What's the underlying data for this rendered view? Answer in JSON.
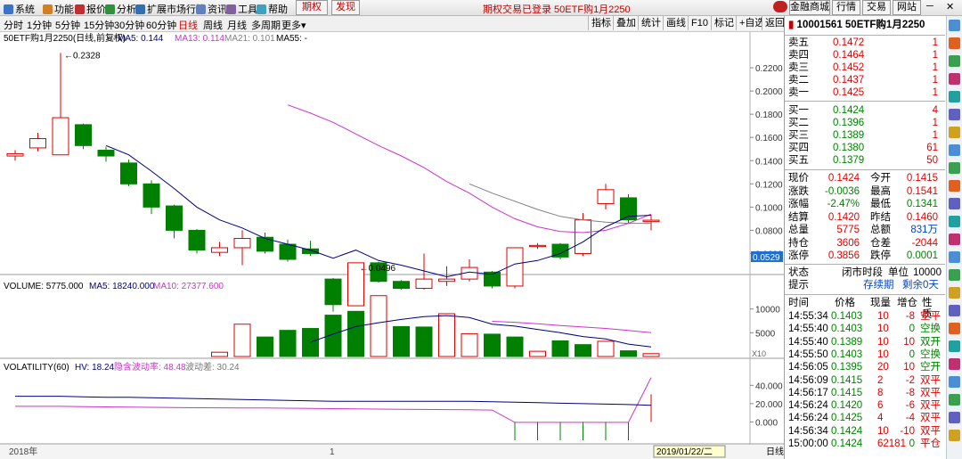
{
  "menu": [
    "系统",
    "功能",
    "报价",
    "分析",
    "扩展市场行情",
    "资讯",
    "工具",
    "帮助"
  ],
  "menu_tags": {
    "qiquan": "期权",
    "faxian": "发现"
  },
  "title_bar": "期权交易已登录  50ETF购1月2250",
  "top_buttons": [
    "金融商城",
    "行情",
    "交易",
    "网站"
  ],
  "periods": [
    "分时",
    "1分钟",
    "5分钟",
    "15分钟",
    "30分钟",
    "60分钟",
    "日线",
    "周线",
    "月线",
    "多周期",
    "更多"
  ],
  "toolbar": [
    "指标",
    "叠加",
    "统计",
    "画线",
    "F10",
    "标记",
    "+自选",
    "返回"
  ],
  "chart_data": [
    {
      "type": "candlestick",
      "title": "50ETF购1月2250(日线,前复权)",
      "ma_labels": {
        "ma5": "MA5: 0.144",
        "ma13": "MA13: 0.114",
        "ma21": "MA21: 0.101",
        "ma55": "MA55: -"
      },
      "ylim": [
        0.045,
        0.24
      ],
      "y_ticks": [
        "0.2200",
        "0.2000",
        "0.1800",
        "0.1600",
        "0.1400",
        "0.1200",
        "0.1000",
        "0.0800",
        "0.0600"
      ],
      "y_tick_values": [
        0.22,
        0.2,
        0.18,
        0.16,
        0.14,
        0.12,
        0.1,
        0.08,
        0.06
      ],
      "low_tag": "0.0529",
      "annotations": {
        "high": "0.2328",
        "low": "0.0496"
      },
      "candles": [
        {
          "o": 0.144,
          "c": 0.146,
          "h": 0.149,
          "l": 0.14
        },
        {
          "o": 0.151,
          "c": 0.159,
          "h": 0.164,
          "l": 0.148
        },
        {
          "o": 0.145,
          "c": 0.177,
          "h": 0.2328,
          "l": 0.145
        },
        {
          "o": 0.171,
          "c": 0.153,
          "h": 0.172,
          "l": 0.15
        },
        {
          "o": 0.149,
          "c": 0.144,
          "h": 0.152,
          "l": 0.139
        },
        {
          "o": 0.138,
          "c": 0.12,
          "h": 0.141,
          "l": 0.118
        },
        {
          "o": 0.12,
          "c": 0.1,
          "h": 0.123,
          "l": 0.094
        },
        {
          "o": 0.101,
          "c": 0.08,
          "h": 0.102,
          "l": 0.073
        },
        {
          "o": 0.08,
          "c": 0.063,
          "h": 0.081,
          "l": 0.06
        },
        {
          "o": 0.061,
          "c": 0.065,
          "h": 0.07,
          "l": 0.058
        },
        {
          "o": 0.065,
          "c": 0.073,
          "h": 0.08,
          "l": 0.05
        },
        {
          "o": 0.074,
          "c": 0.062,
          "h": 0.078,
          "l": 0.06
        },
        {
          "o": 0.068,
          "c": 0.055,
          "h": 0.072,
          "l": 0.053
        },
        {
          "o": 0.064,
          "c": 0.06,
          "h": 0.071,
          "l": 0.058
        },
        {
          "o": 0.038,
          "c": 0.016,
          "h": 0.039,
          "l": 0.01
        },
        {
          "o": 0.015,
          "c": 0.052,
          "h": 0.052,
          "l": 0.0496
        },
        {
          "o": 0.052,
          "c": 0.036,
          "h": 0.053,
          "l": 0.035
        },
        {
          "o": 0.036,
          "c": 0.03,
          "h": 0.037,
          "l": 0.029
        },
        {
          "o": 0.03,
          "c": 0.038,
          "h": 0.06,
          "l": 0.029
        },
        {
          "o": 0.036,
          "c": 0.038,
          "h": 0.049,
          "l": 0.032
        },
        {
          "o": 0.038,
          "c": 0.048,
          "h": 0.055,
          "l": 0.036
        },
        {
          "o": 0.044,
          "c": 0.032,
          "h": 0.045,
          "l": 0.03
        },
        {
          "o": 0.032,
          "c": 0.065,
          "h": 0.065,
          "l": 0.03
        },
        {
          "o": 0.066,
          "c": 0.067,
          "h": 0.069,
          "l": 0.064
        },
        {
          "o": 0.068,
          "c": 0.057,
          "h": 0.069,
          "l": 0.055
        },
        {
          "o": 0.06,
          "c": 0.089,
          "h": 0.095,
          "l": 0.058
        },
        {
          "o": 0.103,
          "c": 0.115,
          "h": 0.12,
          "l": 0.098
        },
        {
          "o": 0.108,
          "c": 0.089,
          "h": 0.111,
          "l": 0.086
        },
        {
          "o": 0.0875,
          "c": 0.0887,
          "h": 0.093,
          "l": 0.08
        }
      ],
      "ma5": [
        null,
        null,
        null,
        null,
        0.153,
        0.145,
        0.131,
        0.116,
        0.1,
        0.089,
        0.082,
        0.073,
        0.068,
        0.063,
        0.056,
        0.063,
        0.054,
        0.05,
        0.045,
        0.04,
        0.044,
        0.042,
        0.051,
        0.054,
        0.06,
        0.07,
        0.083,
        0.092,
        0.093
      ],
      "ma13": [
        null,
        null,
        null,
        null,
        null,
        null,
        null,
        null,
        null,
        null,
        null,
        null,
        0.188,
        0.181,
        0.173,
        0.163,
        0.153,
        0.144,
        0.134,
        0.122,
        0.112,
        0.1,
        0.09,
        0.083,
        0.079,
        0.078,
        0.08,
        0.086,
        0.094
      ],
      "ma21": [
        null,
        null,
        null,
        null,
        null,
        null,
        null,
        null,
        null,
        null,
        null,
        null,
        null,
        null,
        null,
        null,
        null,
        null,
        null,
        null,
        0.12,
        0.112,
        0.105,
        0.098,
        0.092,
        0.089,
        0.087,
        0.086,
        0.086
      ]
    },
    {
      "type": "bar",
      "title": "VOLUME",
      "labels": {
        "vol": "VOLUME: 5775.000",
        "ma5": "MA5: 18240.000",
        "ma10": "MA10: 27377.600"
      },
      "y_ticks": [
        "10000",
        "5000"
      ],
      "y_tick_values": [
        10000,
        5000
      ],
      "ylim": [
        0,
        13500
      ],
      "values": [
        0,
        0,
        0,
        0,
        0,
        0,
        0,
        0,
        0,
        900,
        6800,
        4100,
        5500,
        5900,
        8700,
        9500,
        12800,
        6300,
        6200,
        9000,
        4800,
        4700,
        4100,
        1100,
        3300,
        2500,
        3200,
        1200,
        600
      ],
      "up": [
        true,
        true,
        true,
        false,
        false,
        false,
        false,
        false,
        false,
        true,
        true,
        false,
        false,
        false,
        false,
        false,
        true,
        false,
        false,
        true,
        true,
        false,
        false,
        true,
        false,
        false,
        true,
        false,
        true
      ],
      "ma5": [
        null,
        null,
        null,
        null,
        null,
        null,
        null,
        null,
        null,
        null,
        null,
        null,
        null,
        3000,
        4700,
        6300,
        7100,
        7800,
        8400,
        8600,
        8200,
        6800,
        6400,
        5700,
        5000,
        4200,
        3700,
        2600,
        2000
      ],
      "ma10": [
        null,
        null,
        null,
        null,
        null,
        null,
        null,
        null,
        null,
        null,
        null,
        null,
        null,
        null,
        null,
        null,
        null,
        null,
        null,
        null,
        null,
        7400,
        7200,
        6900,
        6500,
        6200,
        5900,
        5500,
        5000
      ],
      "x10_tag": "X10"
    },
    {
      "type": "line",
      "title": "VOLATILITY(60)",
      "labels": {
        "hv": "HV: 18.24",
        "iv": "隐含波动率: 48.48",
        "bdc": "波动差: 30.24"
      },
      "y_ticks": [
        "40.000",
        "20.000",
        "0.000"
      ],
      "y_tick_values": [
        40,
        20,
        0
      ],
      "ylim": [
        -22,
        52
      ],
      "hv": [
        28,
        28,
        28,
        27.5,
        27,
        27,
        26.5,
        26,
        25.5,
        25,
        24.5,
        24,
        23.5,
        23,
        22.5,
        22.5,
        22.5,
        22.5,
        22.5,
        22.5,
        22.5,
        22,
        21.5,
        21,
        20.5,
        20,
        19.5,
        19,
        18.24
      ],
      "iv": [
        17,
        17,
        17,
        16.8,
        16.5,
        16.2,
        16,
        15.8,
        15.5,
        15.4,
        15.3,
        15.2,
        15,
        14.8,
        14.5,
        14.3,
        14,
        13.8,
        13.6,
        13.4,
        13.2,
        13,
        -0.5,
        -0.5,
        -0.5,
        -0.5,
        -0.5,
        -0.5,
        48.48
      ],
      "bdc": [
        null,
        null,
        null,
        null,
        null,
        null,
        null,
        null,
        null,
        null,
        null,
        null,
        null,
        null,
        null,
        null,
        null,
        null,
        null,
        null,
        null,
        null,
        -20,
        -20,
        -20,
        -20,
        -20,
        -20,
        30.24
      ]
    }
  ],
  "x_axis": {
    "left": "2018年",
    "mark": "1",
    "date_tag": "2019/01/22/二",
    "period_tag": "日线"
  },
  "quote": {
    "code_name": "10001561 50ETF购1月2250",
    "asks": [
      {
        "label": "卖五",
        "price": "0.1472",
        "vol": "1"
      },
      {
        "label": "卖四",
        "price": "0.1464",
        "vol": "1"
      },
      {
        "label": "卖三",
        "price": "0.1452",
        "vol": "1"
      },
      {
        "label": "卖二",
        "price": "0.1437",
        "vol": "1"
      },
      {
        "label": "卖一",
        "price": "0.1425",
        "vol": "1"
      }
    ],
    "bids": [
      {
        "label": "买一",
        "price": "0.1424",
        "vol": "4"
      },
      {
        "label": "买二",
        "price": "0.1396",
        "vol": "1"
      },
      {
        "label": "买三",
        "price": "0.1389",
        "vol": "1"
      },
      {
        "label": "买四",
        "price": "0.1380",
        "vol": "61"
      },
      {
        "label": "买五",
        "price": "0.1379",
        "vol": "50"
      }
    ],
    "stats": [
      {
        "l1": "现价",
        "v1": "0.1424",
        "l2": "今开",
        "v2": "0.1415"
      },
      {
        "l1": "涨跌",
        "v1": "-0.0036",
        "l2": "最高",
        "v2": "0.1541"
      },
      {
        "l1": "涨幅",
        "v1": "-2.47%",
        "l2": "最低",
        "v2": "0.1341"
      },
      {
        "l1": "结算",
        "v1": "0.1420",
        "l2": "昨结",
        "v2": "0.1460"
      },
      {
        "l1": "总量",
        "v1": "5775",
        "l2": "总额",
        "v2": "831万"
      },
      {
        "l1": "持仓",
        "v1": "3606",
        "l2": "仓差",
        "v2": "-2044"
      },
      {
        "l1": "涨停",
        "v1": "0.3856",
        "l2": "跌停",
        "v2": "0.0001"
      }
    ],
    "status": {
      "label": "状态",
      "value": "闭市时段",
      "unit_label": "单位",
      "unit": "10000"
    },
    "hint": {
      "label": "提示",
      "v1": "存续期",
      "v2": "剩余0天"
    },
    "tick_headers": [
      "时间",
      "价格",
      "现量",
      "增仓",
      "性质"
    ],
    "ticks": [
      {
        "t": "14:55:34",
        "p": "0.1403",
        "v": "10",
        "z": "-8",
        "x": "空平"
      },
      {
        "t": "14:55:40",
        "p": "0.1403",
        "v": "10",
        "z": "0",
        "x": "空换"
      },
      {
        "t": "14:55:40",
        "p": "0.1389",
        "v": "10",
        "z": "10",
        "x": "双开"
      },
      {
        "t": "14:55:50",
        "p": "0.1403",
        "v": "10",
        "z": "0",
        "x": "空换"
      },
      {
        "t": "14:56:05",
        "p": "0.1395",
        "v": "20",
        "z": "10",
        "x": "空开"
      },
      {
        "t": "14:56:09",
        "p": "0.1415",
        "v": "2",
        "z": "-2",
        "x": "双平"
      },
      {
        "t": "14:56:17",
        "p": "0.1415",
        "v": "8",
        "z": "-8",
        "x": "双平"
      },
      {
        "t": "14:56:24",
        "p": "0.1420",
        "v": "6",
        "z": "-6",
        "x": "双平"
      },
      {
        "t": "14:56:24",
        "p": "0.1425",
        "v": "4",
        "z": "-4",
        "x": "双平"
      },
      {
        "t": "14:56:34",
        "p": "0.1424",
        "v": "10",
        "z": "-10",
        "x": "双平"
      },
      {
        "t": "15:00:00",
        "p": "0.1424",
        "v": "62181",
        "z": "0",
        "x": "平仓"
      }
    ]
  },
  "colors": {
    "up": "#e00000",
    "down": "#008000",
    "ma5": "#000080",
    "ma13": "#cc33cc",
    "ma21": "#808080",
    "bg": "#ffffff"
  }
}
